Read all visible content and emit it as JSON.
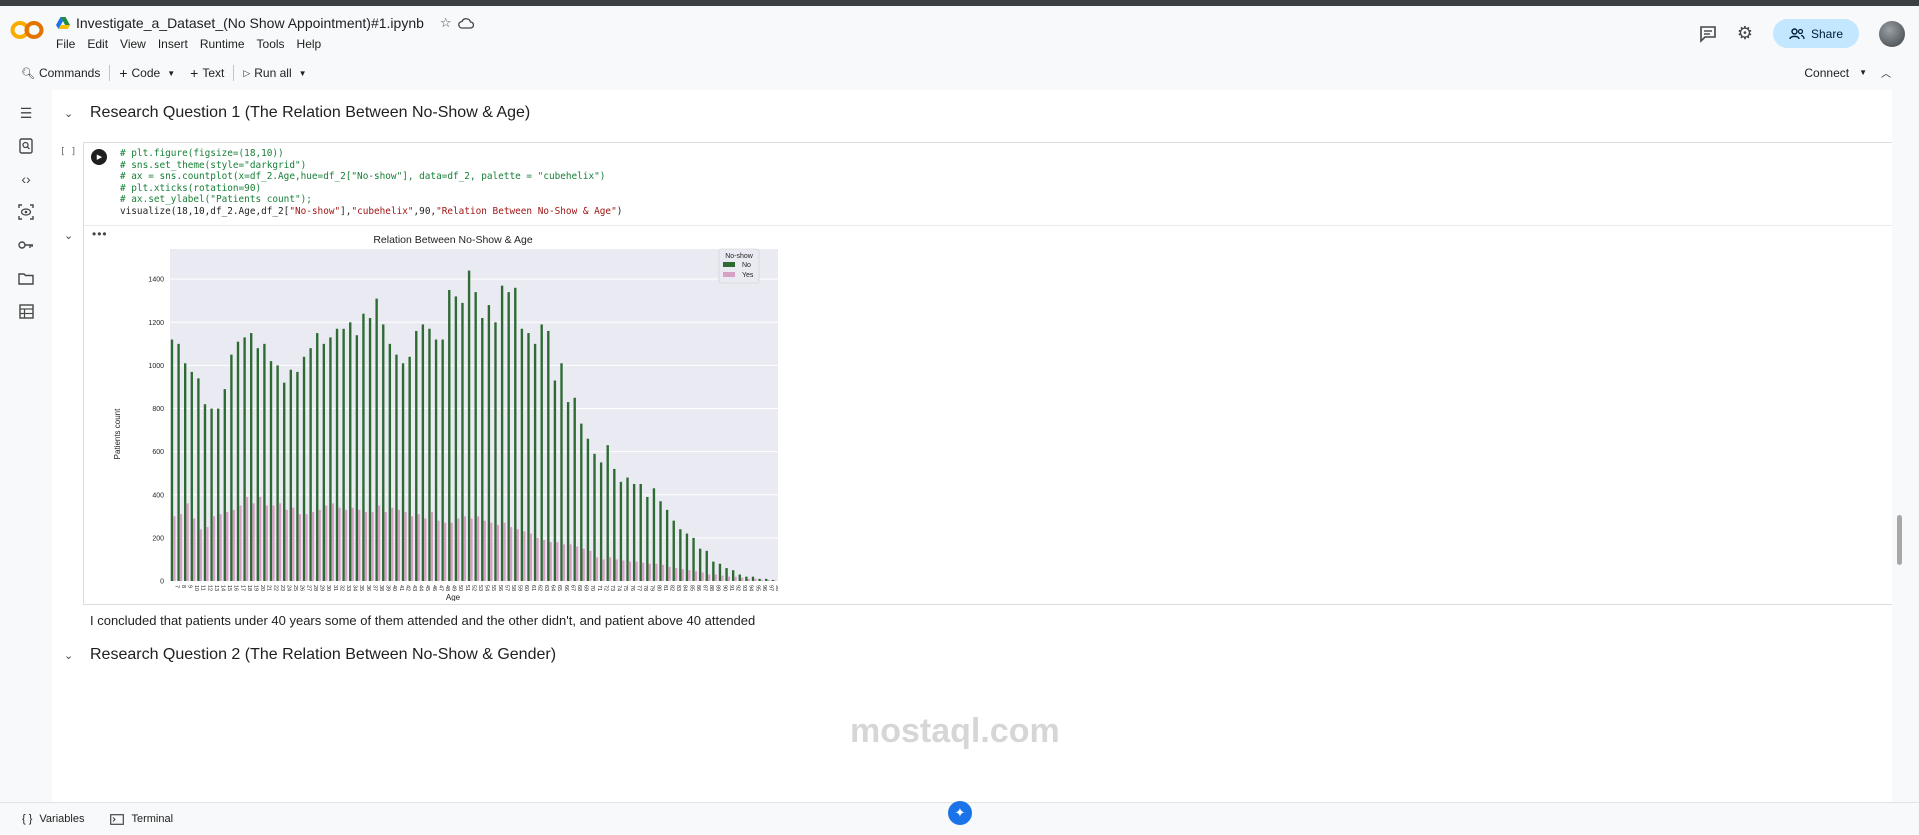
{
  "header": {
    "title": "Investigate_a_Dataset_(No Show Appointment)#1.ipynb",
    "menu": [
      "File",
      "Edit",
      "View",
      "Insert",
      "Runtime",
      "Tools",
      "Help"
    ],
    "share_label": "Share"
  },
  "toolbar": {
    "commands": "Commands",
    "code": "Code",
    "text": "Text",
    "run_all": "Run all",
    "connect": "Connect"
  },
  "section1_title": "Research Question 1 (The Relation Between No-Show & Age)",
  "section2_title": "Research Question 2 (The Relation Between No-Show & Gender)",
  "cell": {
    "exec_count": "[ ]",
    "lines": [
      "# plt.figure(figsize=(18,10))",
      "# sns.set_theme(style=\"darkgrid\")",
      "# ax = sns.countplot(x=df_2.Age,hue=df_2[\"No-show\"], data=df_2, palette = \"cubehelix\")",
      "# plt.xticks(rotation=90)",
      "# ax.set_ylabel(\"Patients count\");"
    ],
    "last_line": {
      "p1": "visualize(18,10,df_2.Age,df_2[",
      "s1": "\"No-show\"",
      "p2": "],",
      "s2": "\"cubehelix\"",
      "p3": ",90,",
      "s3": "\"Relation Between No-Show & Age\"",
      "p4": ")"
    }
  },
  "conclusion": "I concluded that patients under 40 years some of them attended and the other didn't, and patient above 40 attended",
  "watermark": "mostaql.com",
  "statusbar": {
    "variables": "Variables",
    "terminal": "Terminal"
  },
  "colors": {
    "no": "#2e6b33",
    "yes": "#d7a1c6",
    "plot_bg": "#eaeaf2",
    "accent": "#1a73e8"
  },
  "chart_data": {
    "type": "bar",
    "title": "Relation Between No-Show & Age",
    "xlabel": "Age",
    "ylabel": "Patients count",
    "ylim": [
      0,
      1540
    ],
    "yticks": [
      0,
      200,
      400,
      600,
      800,
      1000,
      1200,
      1400
    ],
    "grid": true,
    "legend_title": "No-show",
    "legend_position": "top-right",
    "categories": [
      "7",
      "8",
      "9",
      "10",
      "11",
      "12",
      "13",
      "14",
      "15",
      "16",
      "17",
      "18",
      "19",
      "20",
      "21",
      "22",
      "23",
      "24",
      "25",
      "26",
      "27",
      "28",
      "29",
      "30",
      "31",
      "32",
      "33",
      "34",
      "35",
      "36",
      "37",
      "38",
      "39",
      "40",
      "41",
      "42",
      "43",
      "44",
      "45",
      "46",
      "47",
      "48",
      "49",
      "50",
      "51",
      "52",
      "53",
      "54",
      "55",
      "56",
      "57",
      "58",
      "59",
      "60",
      "61",
      "62",
      "63",
      "64",
      "65",
      "66",
      "67",
      "68",
      "69",
      "70",
      "71",
      "72",
      "73",
      "74",
      "75",
      "76",
      "77",
      "78",
      "79",
      "80",
      "81",
      "82",
      "83",
      "84",
      "85",
      "86",
      "87",
      "88",
      "89",
      "90",
      "91",
      "92",
      "93",
      "94",
      "95",
      "96",
      "97",
      "98",
      "99"
    ],
    "series": [
      {
        "name": "No",
        "values": [
          1120,
          1100,
          1010,
          970,
          940,
          820,
          800,
          800,
          890,
          1050,
          1110,
          1130,
          1150,
          1080,
          1100,
          1020,
          1000,
          920,
          980,
          970,
          1040,
          1080,
          1150,
          1100,
          1130,
          1170,
          1170,
          1200,
          1140,
          1240,
          1220,
          1310,
          1190,
          1100,
          1050,
          1010,
          1040,
          1160,
          1190,
          1170,
          1120,
          1120,
          1350,
          1320,
          1290,
          1440,
          1340,
          1220,
          1280,
          1200,
          1370,
          1340,
          1360,
          1170,
          1150,
          1100,
          1190,
          1160,
          930,
          1010,
          830,
          850,
          730,
          660,
          590,
          550,
          630,
          520,
          460,
          480,
          450,
          450,
          390,
          430,
          370,
          330,
          280,
          240,
          220,
          200,
          150,
          140,
          90,
          80,
          60,
          50,
          30,
          20,
          20,
          10,
          10,
          5,
          5
        ]
      },
      {
        "name": "Yes",
        "values": [
          300,
          310,
          360,
          290,
          240,
          250,
          300,
          310,
          320,
          330,
          350,
          390,
          360,
          390,
          350,
          350,
          360,
          330,
          340,
          310,
          310,
          320,
          330,
          350,
          360,
          340,
          330,
          340,
          330,
          320,
          320,
          350,
          320,
          340,
          330,
          320,
          300,
          310,
          290,
          320,
          280,
          270,
          270,
          290,
          300,
          290,
          300,
          280,
          270,
          260,
          270,
          250,
          240,
          230,
          220,
          200,
          190,
          180,
          180,
          170,
          170,
          160,
          150,
          140,
          110,
          100,
          110,
          100,
          95,
          90,
          90,
          85,
          80,
          80,
          75,
          65,
          60,
          55,
          50,
          45,
          40,
          30,
          30,
          25,
          20,
          20,
          15,
          10,
          10,
          5,
          5,
          3,
          2
        ]
      }
    ]
  }
}
